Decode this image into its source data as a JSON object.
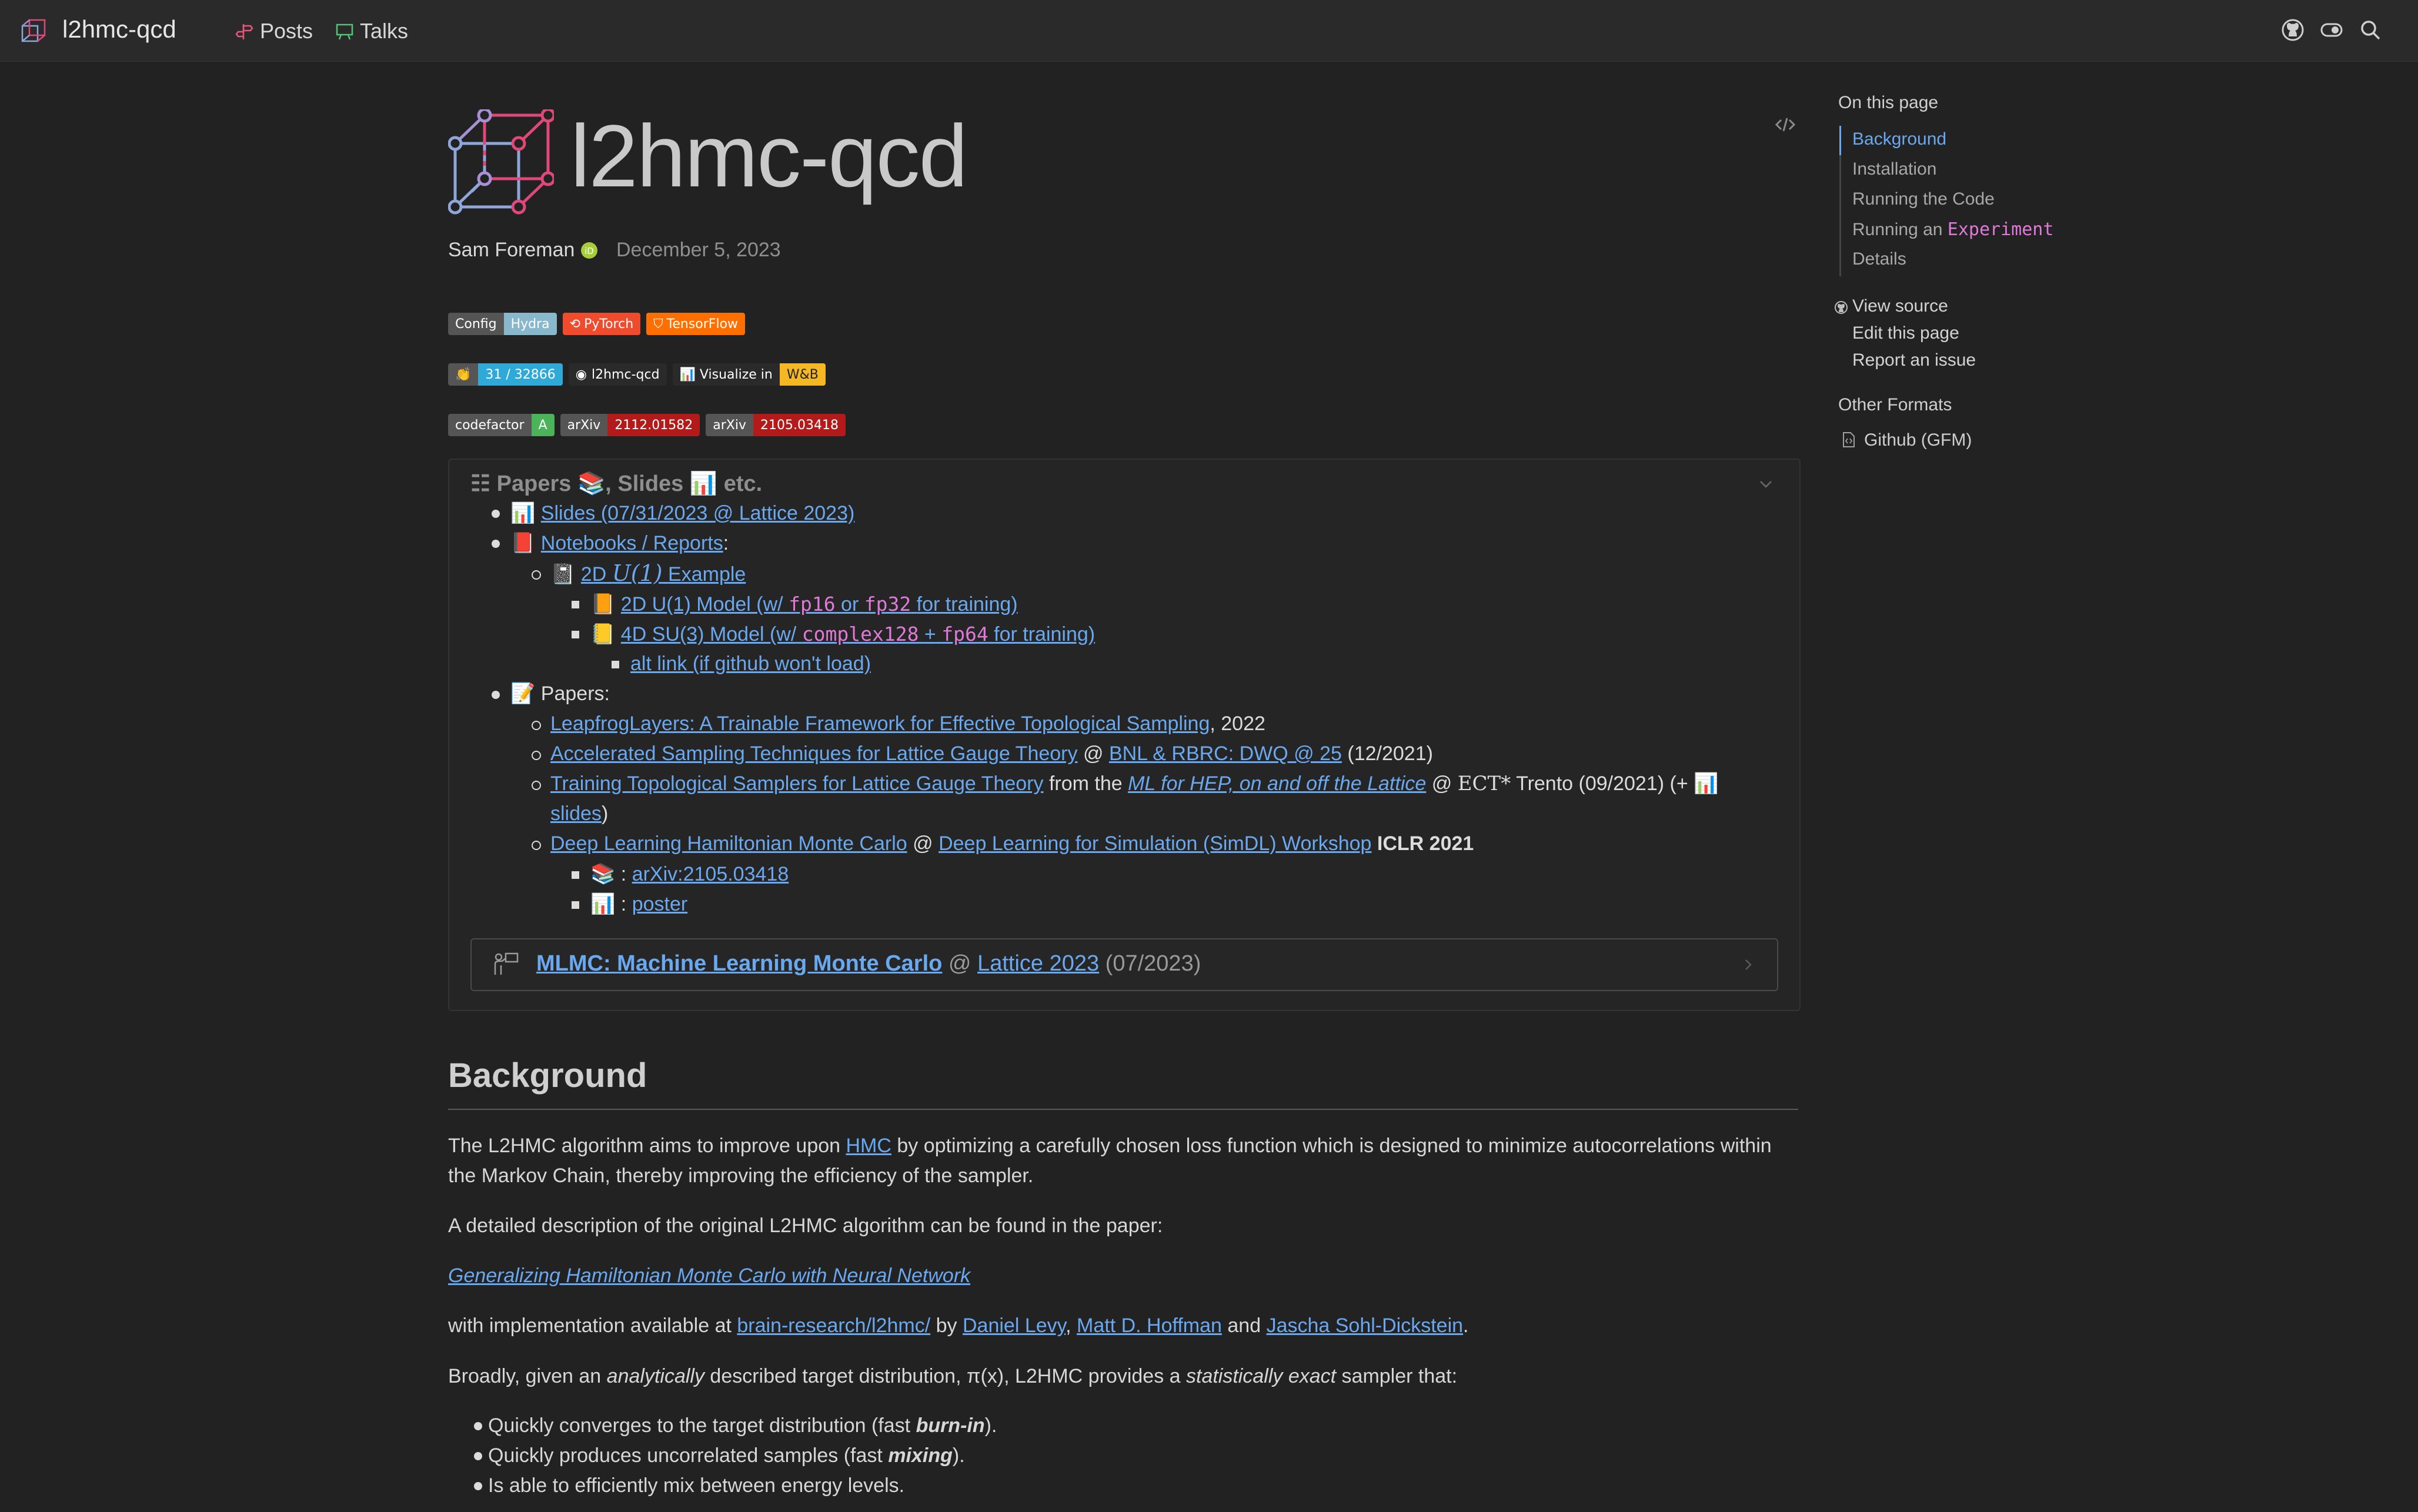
{
  "nav": {
    "title": "l2hmc-qcd",
    "posts": "Posts",
    "talks": "Talks"
  },
  "header": {
    "title": "l2hmc-qcd",
    "author": "Sam Foreman",
    "date": "December 5, 2023"
  },
  "badges": {
    "row1": [
      {
        "left": "Config",
        "right": "Hydra"
      },
      {
        "label": "PyTorch"
      },
      {
        "label": "TensorFlow"
      }
    ],
    "row2": [
      {
        "left": "👏",
        "right": "31 / 32866"
      },
      {
        "label": "l2hmc-qcd"
      },
      {
        "left": "📊 Visualize in",
        "right": "W&B"
      }
    ],
    "row3": [
      {
        "left": "codefactor",
        "right": "A"
      },
      {
        "left": "arXiv",
        "right": "2112.01582"
      },
      {
        "left": "arXiv",
        "right": "2105.03418"
      }
    ]
  },
  "callout": {
    "header": "📚, Slides 📊 etc.",
    "header_prefix": "Papers",
    "slides_emoji": "📊",
    "slides_link": "Slides (07/31/2023 @ Lattice 2023)",
    "notebooks_emoji": "📕",
    "notebooks_link": "Notebooks / Reports",
    "notebooks_colon": ":",
    "u1_emoji": "📓",
    "u1_link_pre": "2D",
    "u1_math": "U(1)",
    "u1_link_post": "Example",
    "fp_emoji": "📙",
    "fp_link_pre": "2D U(1) Model (w/",
    "fp16": "fp16",
    "fp_or": "or",
    "fp32": "fp32",
    "fp_link_post": "for training)",
    "su3_emoji": "📒",
    "su3_link_pre": "4D SU(3) Model (w/",
    "complex128": "complex128",
    "plus": "+",
    "fp64": "fp64",
    "su3_link_post": "for training)",
    "alt_link": "alt link (if github won't load)",
    "papers_emoji": "📝",
    "papers_label": "Papers:",
    "paper1_link": "LeapfrogLayers: A Trainable Framework for Effective Topological Sampling",
    "paper1_year": ", 2022",
    "paper2_link": "Accelerated Sampling Techniques for Lattice Gauge Theory",
    "paper2_at": " @ ",
    "paper2_venue": "BNL & RBRC: DWQ @ 25",
    "paper2_date": " (12/2021)",
    "paper3_link": "Training Topological Samplers for Lattice Gauge Theory",
    "paper3_from": " from the ",
    "paper3_venue": "ML for HEP, on and off the Lattice",
    "paper3_at": " @ ",
    "paper3_ect": "ECT*",
    "paper3_trento": " Trento (09/2021) (+ 📊",
    "paper3_slides": "slides",
    "paper3_close": ")",
    "paper4_link": "Deep Learning Hamiltonian Monte Carlo",
    "paper4_at": " @ ",
    "paper4_venue": "Deep Learning for Simulation (SimDL) Workshop",
    "paper4_conf": " ICLR 2021",
    "paper4_arxiv_prefix": "📚 : ",
    "paper4_arxiv": "arXiv:2105.03418",
    "paper4_poster_prefix": "📊 : ",
    "paper4_poster": "poster",
    "mlmc_link": "MLMC: Machine Learning Monte Carlo",
    "mlmc_at": " @ ",
    "mlmc_venue": "Lattice 2023",
    "mlmc_date": " (07/2023)"
  },
  "background": {
    "heading": "Background",
    "p1_pre": "The L2HMC algorithm aims to improve upon ",
    "p1_link": "HMC",
    "p1_post": " by optimizing a carefully chosen loss function which is designed to minimize autocorrelations within the Markov Chain, thereby improving the efficiency of the sampler.",
    "p2": "A detailed description of the original L2HMC algorithm can be found in the paper:",
    "p3_link": "Generalizing Hamiltonian Monte Carlo with Neural Network",
    "p4_pre": "with implementation available at ",
    "p4_repo": "brain-research/l2hmc/",
    "p4_by": " by ",
    "p4_a1": "Daniel Levy",
    "p4_c1": ", ",
    "p4_a2": "Matt D. Hoffman",
    "p4_and": " and ",
    "p4_a3": "Jascha Sohl-Dickstein",
    "p4_end": ".",
    "p5_a": "Broadly, given an ",
    "p5_b": "analytically",
    "p5_c": " described target distribution, π(x), L2HMC provides a ",
    "p5_d": "statistically exact",
    "p5_e": " sampler that:",
    "li1_pre": "Quickly converges to the target distribution (fast ",
    "li1_em": "burn-in",
    "li1_post": ").",
    "li2_pre": "Quickly produces uncorrelated samples (fast ",
    "li2_em": "mixing",
    "li2_post": ").",
    "li3": "Is able to efficiently mix between energy levels."
  },
  "toc": {
    "title": "On this page",
    "items": [
      "Background",
      "Installation",
      "Running the Code",
      "Running an ",
      "Details"
    ],
    "experiment_code": "Experiment",
    "view_source": "View source",
    "edit_page": "Edit this page",
    "report_issue": "Report an issue",
    "other_formats": "Other Formats",
    "gfm": "Github (GFM)"
  },
  "colors": {
    "background": "#222222",
    "navbar": "#2a2a2a",
    "link": "#6aa9f0",
    "code": "#e07ad8"
  }
}
